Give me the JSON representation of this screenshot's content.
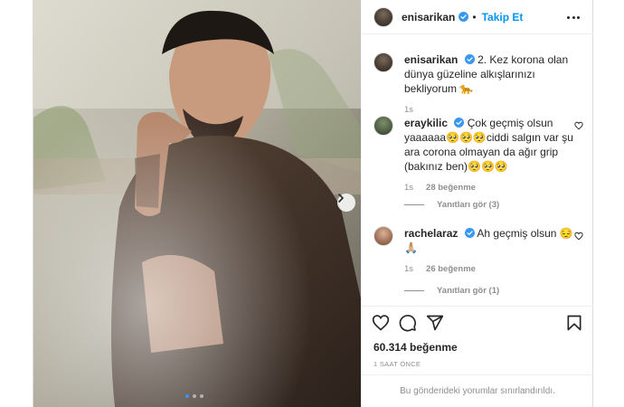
{
  "post": {
    "username": "enisarikan",
    "follow_separator": "•",
    "follow_label": "Takip Et",
    "caption": "2. Kez korona olan dünya güzeline alkışlarınızı bekliyorum 🐆",
    "caption_time": "1s",
    "likes_count": "60.314 beğenme",
    "posted_ago": "1 SAAT ÖNCE",
    "comments_limited": "Bu gönderideki yorumlar sınırlandırıldı.",
    "carousel": {
      "slides": 3,
      "active": 0
    }
  },
  "comments": [
    {
      "username": "eraykilic",
      "text": "Çok geçmiş olsun yaaaaaa🥺🥺🥺ciddi salgın var şu ara corona olmayan da ağır grip (bakınız ben)🥺🥺🥺",
      "time": "1s",
      "likes": "28 beğenme",
      "replies": "Yanıtları gör (3)"
    },
    {
      "username": "rachelaraz",
      "text": "Ah geçmiş olsun 😔🙏🏼",
      "time": "1s",
      "likes": "26 beğenme",
      "replies": "Yanıtları gör (1)"
    }
  ],
  "icons": {
    "verified": "verified-badge-icon",
    "more": "more-options-icon",
    "heart": "heart-icon",
    "comment": "comment-icon",
    "share": "share-icon",
    "save": "bookmark-icon",
    "next": "chevron-right-icon"
  },
  "colors": {
    "accent": "#0095f6",
    "verified": "#3897f0",
    "text": "#262626",
    "muted": "#8e8e8e"
  }
}
